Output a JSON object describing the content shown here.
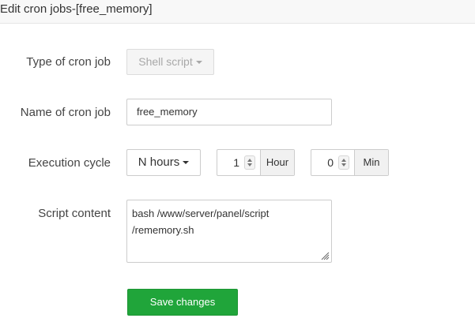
{
  "dialog": {
    "title": "Edit cron jobs-[free_memory]"
  },
  "form": {
    "type_label": "Type of cron job",
    "type_value": "Shell script",
    "name_label": "Name of cron job",
    "name_value": "free_memory",
    "cycle_label": "Execution cycle",
    "cycle_value": "N hours",
    "hours_value": "1",
    "hours_unit": "Hour",
    "minutes_value": "0",
    "minutes_unit": "Min",
    "script_label": "Script content",
    "script_line1": "bash /www/server/panel/script",
    "script_line2": "/rememory.sh",
    "save_label": "Save changes"
  },
  "colors": {
    "accent": "#20a53a",
    "title_bar": "#f8f8f8"
  }
}
